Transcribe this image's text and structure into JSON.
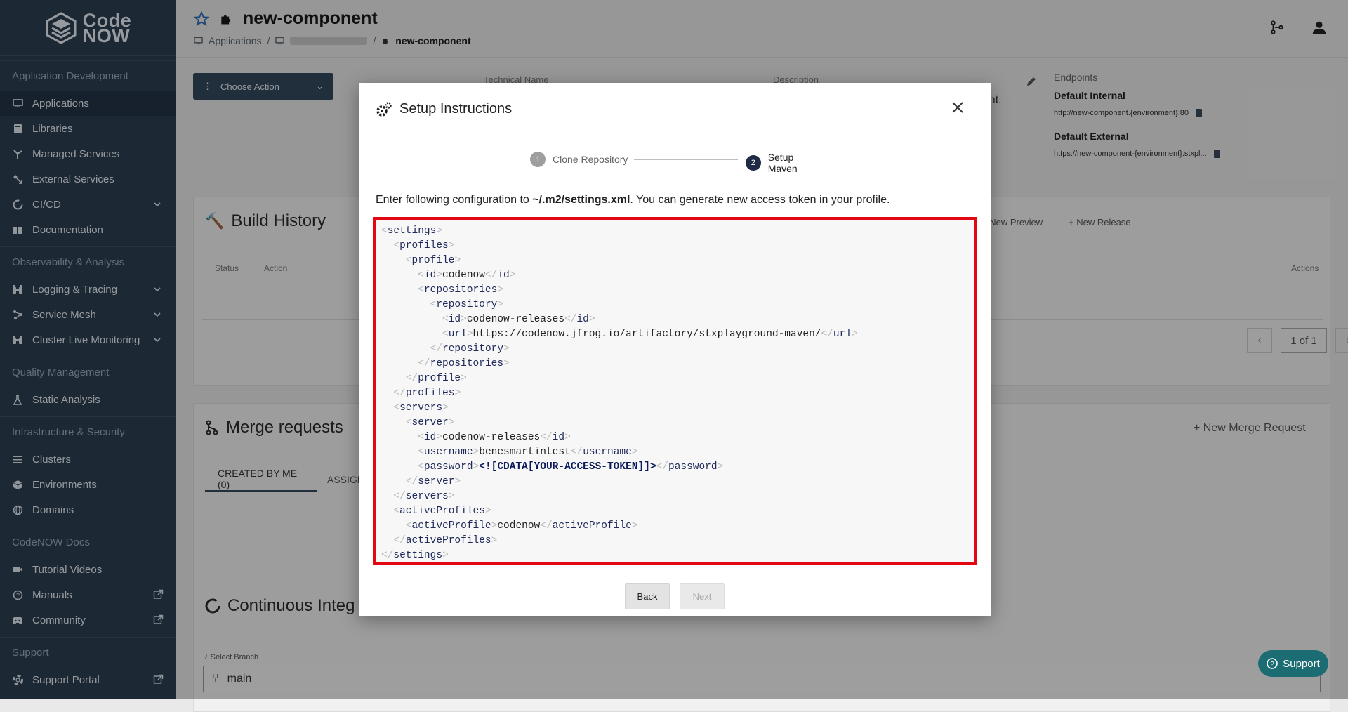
{
  "logo": {
    "line1": "Code",
    "line2": "NOW"
  },
  "sidebar": {
    "sections": [
      {
        "title": "Application Development",
        "items": [
          {
            "label": "Applications",
            "icon": "monitor-icon",
            "active": true
          },
          {
            "label": "Libraries",
            "icon": "book-icon"
          },
          {
            "label": "Managed Services",
            "icon": "services-icon"
          },
          {
            "label": "External Services",
            "icon": "external-services-icon"
          },
          {
            "label": "CI/CD",
            "icon": "cicd-icon",
            "arrow": true
          },
          {
            "label": "Documentation",
            "icon": "documentation-icon"
          }
        ]
      },
      {
        "title": "Observability & Analysis",
        "items": [
          {
            "label": "Logging & Tracing",
            "icon": "binoculars-icon",
            "arrow": true
          },
          {
            "label": "Service Mesh",
            "icon": "mesh-icon",
            "arrow": true
          },
          {
            "label": "Cluster Live Monitoring",
            "icon": "binoculars-icon",
            "arrow": true
          }
        ]
      },
      {
        "title": "Quality Management",
        "items": [
          {
            "label": "Static Analysis",
            "icon": "flask-icon"
          }
        ]
      },
      {
        "title": "Infrastructure & Security",
        "items": [
          {
            "label": "Clusters",
            "icon": "list-icon"
          },
          {
            "label": "Environments",
            "icon": "cube-icon"
          },
          {
            "label": "Domains",
            "icon": "globe-icon"
          }
        ]
      },
      {
        "title": "CodeNOW Docs",
        "items": [
          {
            "label": "Tutorial Videos",
            "icon": "video-icon"
          },
          {
            "label": "Manuals",
            "icon": "question-icon",
            "external": true
          },
          {
            "label": "Community",
            "icon": "discord-icon",
            "external": true
          }
        ]
      },
      {
        "title": "Support",
        "items": [
          {
            "label": "Support Portal",
            "icon": "lifebuoy-icon",
            "external": true
          }
        ]
      }
    ]
  },
  "header": {
    "title": "new-component",
    "breadcrumb": {
      "first": "Applications",
      "separator": "/",
      "last": "new-component"
    }
  },
  "background": {
    "choose_action": "Choose Action",
    "technical_name_label": "Technical Name",
    "description_label": "Description",
    "description_tail": "nent.",
    "endpoints": {
      "label": "Endpoints",
      "internal_title": "Default Internal",
      "internal_url": "http://new-component.{environment}:80",
      "external_title": "Default External",
      "external_url": "https://new-component-{environment}.stxpl..."
    },
    "build_history": {
      "title": "Build History",
      "new_preview": "New Preview",
      "new_release": "New Release",
      "col_status": "Status",
      "col_action": "Action",
      "col_actions": "Actions",
      "pagination": "1 of 1"
    },
    "merge_requests": {
      "title": "Merge requests",
      "new_merge": "New Merge Request",
      "tab_created": "CREATED BY ME (0)",
      "tab_assigned": "ASSIGN"
    },
    "ci": {
      "title": "Continuous Integ",
      "select_branch_label": "Select Branch",
      "branch": "main"
    }
  },
  "modal": {
    "title": "Setup Instructions",
    "steps": [
      {
        "num": "1",
        "label": "Clone Repository",
        "state": "done"
      },
      {
        "num": "2",
        "label": "Setup Maven",
        "state": "active"
      }
    ],
    "instruction_prefix": "Enter following configuration to ",
    "instruction_path": "~/.m2/settings.xml",
    "instruction_mid": ". You can generate new access token in ",
    "instruction_link": "your profile",
    "instruction_end": ".",
    "code_lines": [
      {
        "indent": 0,
        "tag": "settings",
        "type": "open"
      },
      {
        "indent": 1,
        "tag": "profiles",
        "type": "open"
      },
      {
        "indent": 2,
        "tag": "profile",
        "type": "open"
      },
      {
        "indent": 3,
        "tag": "id",
        "type": "inline",
        "value": "codenow"
      },
      {
        "indent": 3,
        "tag": "repositories",
        "type": "open"
      },
      {
        "indent": 4,
        "tag": "repository",
        "type": "open"
      },
      {
        "indent": 5,
        "tag": "id",
        "type": "inline",
        "value": "codenow-releases"
      },
      {
        "indent": 5,
        "tag": "url",
        "type": "inline",
        "value": "https://codenow.jfrog.io/artifactory/stxplayground-maven/"
      },
      {
        "indent": 4,
        "tag": "repository",
        "type": "close"
      },
      {
        "indent": 3,
        "tag": "repositories",
        "type": "close"
      },
      {
        "indent": 2,
        "tag": "profile",
        "type": "close"
      },
      {
        "indent": 1,
        "tag": "profiles",
        "type": "close"
      },
      {
        "indent": 1,
        "tag": "servers",
        "type": "open"
      },
      {
        "indent": 2,
        "tag": "server",
        "type": "open"
      },
      {
        "indent": 3,
        "tag": "id",
        "type": "inline",
        "value": "codenow-releases"
      },
      {
        "indent": 3,
        "tag": "username",
        "type": "inline",
        "value": "benesmartintest"
      },
      {
        "indent": 3,
        "tag": "password",
        "type": "inline",
        "value": "<![CDATA[YOUR-ACCESS-TOKEN]]>",
        "cdata": true
      },
      {
        "indent": 2,
        "tag": "server",
        "type": "close"
      },
      {
        "indent": 1,
        "tag": "servers",
        "type": "close"
      },
      {
        "indent": 1,
        "tag": "activeProfiles",
        "type": "open"
      },
      {
        "indent": 2,
        "tag": "activeProfile",
        "type": "inline",
        "value": "codenow"
      },
      {
        "indent": 1,
        "tag": "activeProfiles",
        "type": "close"
      },
      {
        "indent": 0,
        "tag": "settings",
        "type": "close"
      }
    ],
    "back_label": "Back",
    "next_label": "Next"
  },
  "support_label": "Support",
  "colors": {
    "sidebar": "#2c3e50",
    "accent": "#1c6d73",
    "highlight": "#e30613",
    "step_active": "#1f2a44",
    "step_done": "#9e9e9e"
  }
}
